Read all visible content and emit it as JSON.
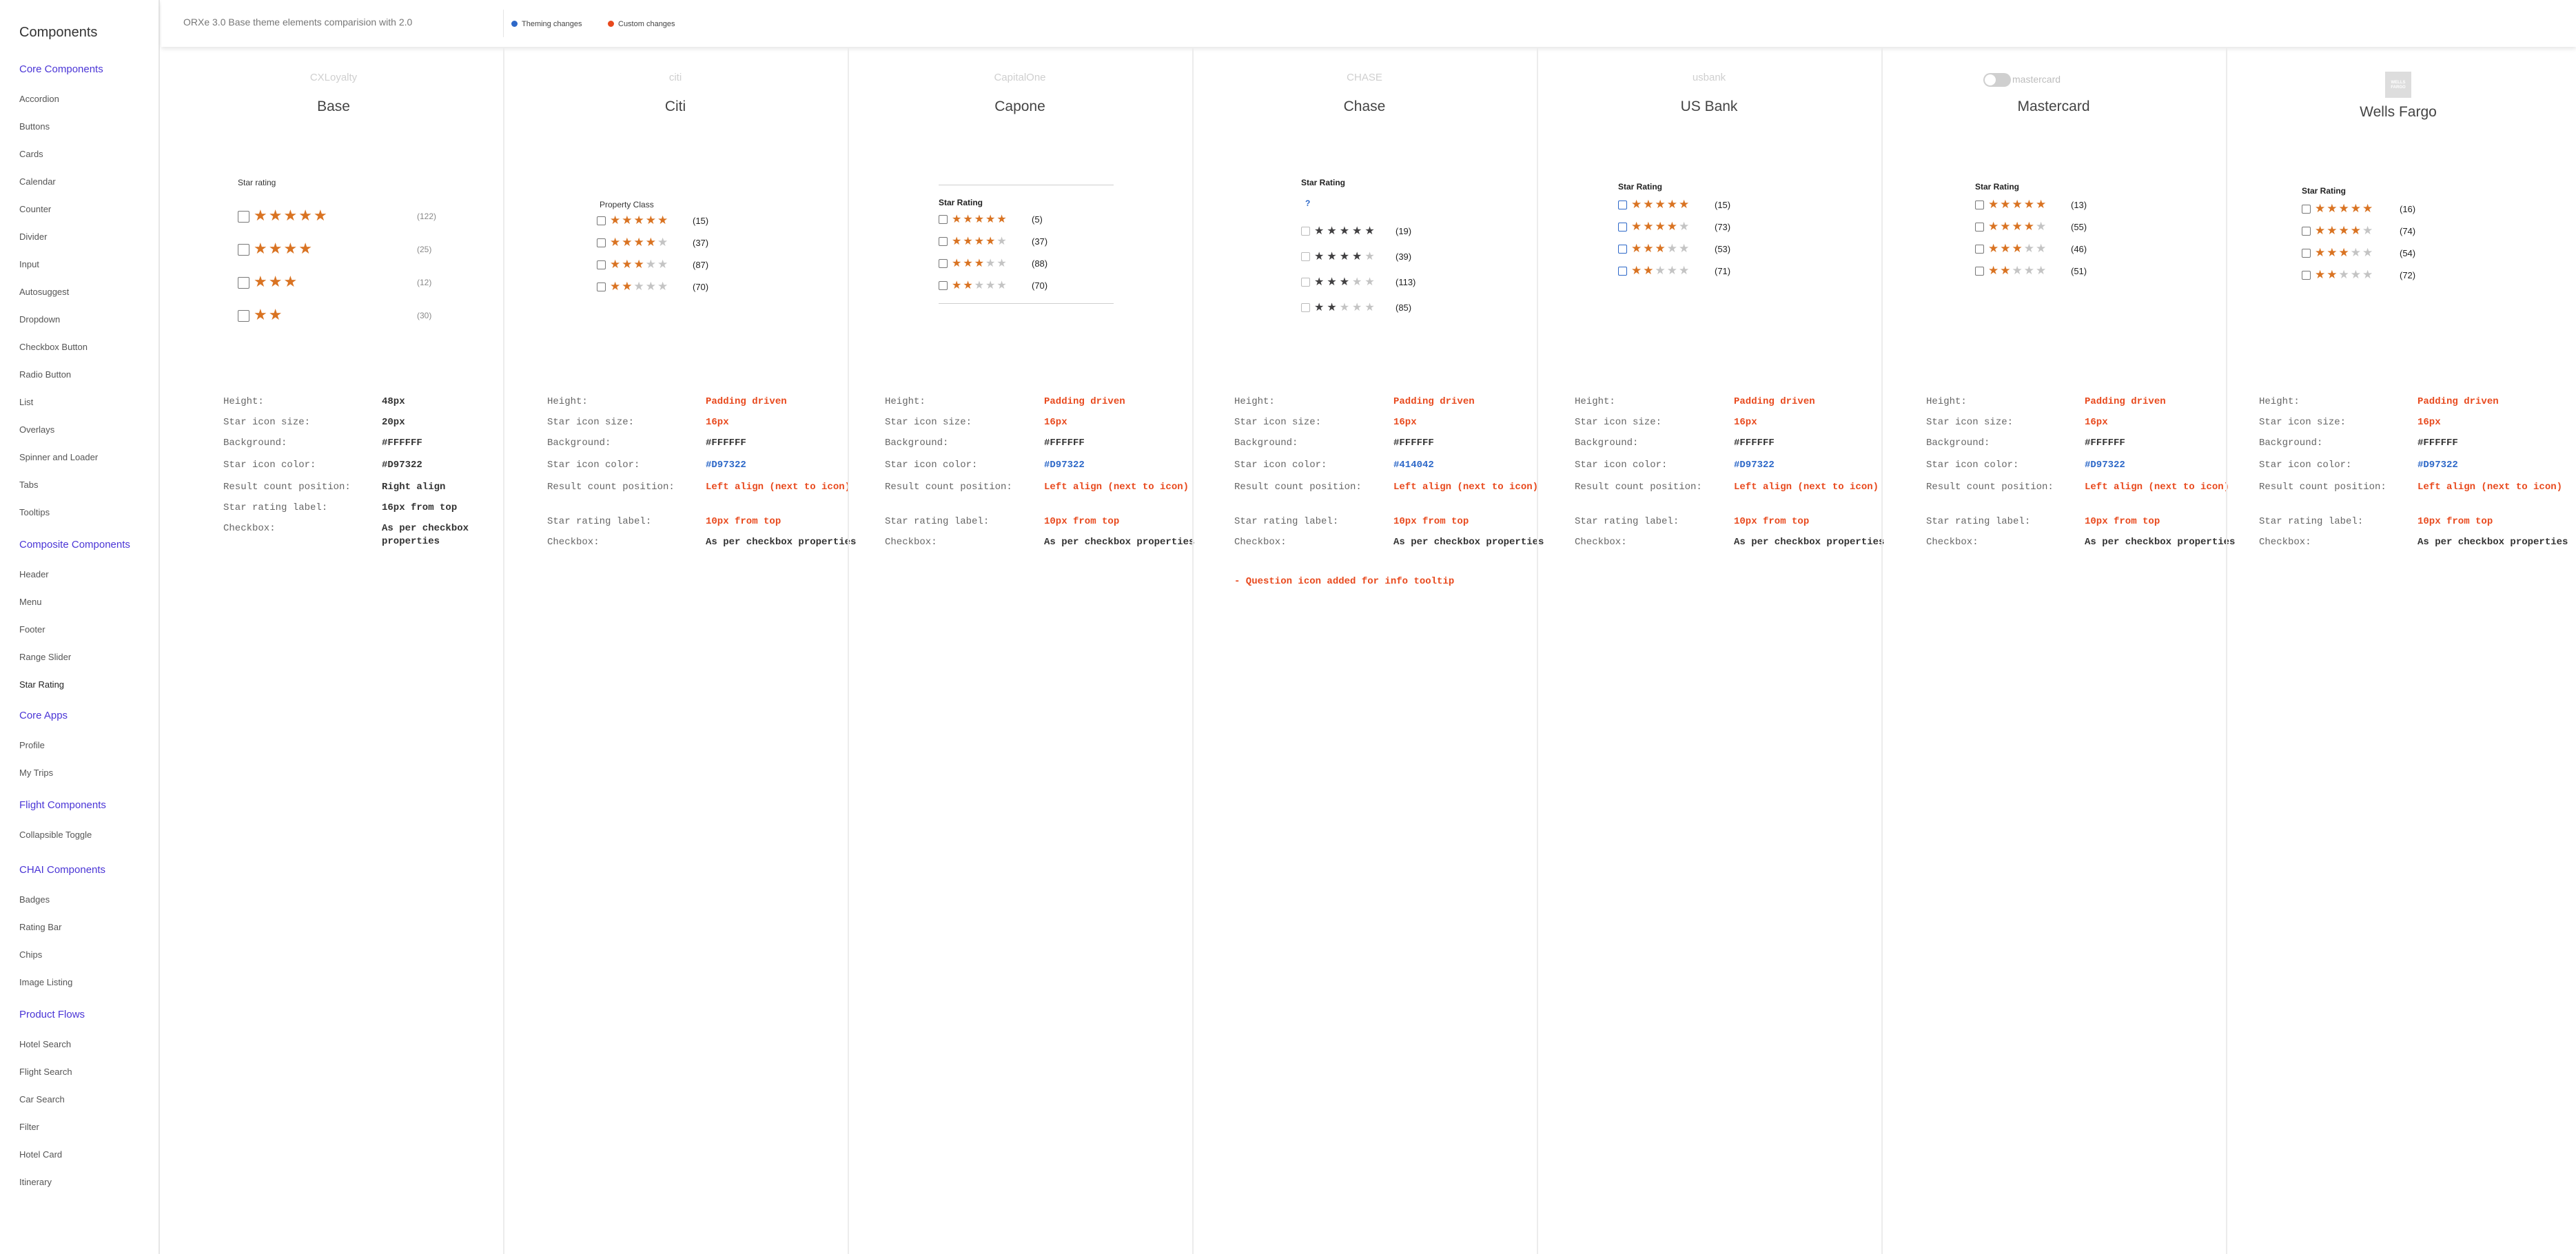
{
  "sidebar": {
    "title": "Components",
    "sections": [
      {
        "label": "Core Components",
        "items": [
          "Accordion",
          "Buttons",
          "Cards",
          "Calendar",
          "Counter",
          "Divider",
          "Input",
          "Autosuggest",
          "Dropdown",
          "Checkbox Button",
          "Radio Button",
          "List",
          "Overlays",
          "Spinner and Loader",
          "Tabs",
          "Tooltips"
        ]
      },
      {
        "label": "Composite Components",
        "items": [
          "Header",
          "Menu",
          "Footer",
          "Range Slider",
          "Star Rating"
        ]
      },
      {
        "label": "Core Apps",
        "items": [
          "Profile",
          "My Trips"
        ]
      },
      {
        "label": "Flight Components",
        "items": [
          "Collapsible Toggle"
        ]
      },
      {
        "label": "CHAI Components",
        "items": [
          "Badges",
          "Rating Bar",
          "Chips",
          "Image Listing"
        ]
      },
      {
        "label": "Product Flows",
        "items": [
          "Hotel Search",
          "Flight Search",
          "Car Search",
          "Filter",
          "Hotel Card",
          "Itinerary"
        ]
      }
    ],
    "active_item": "Star Rating"
  },
  "header": {
    "subtitle": "ORXe 3.0 Base theme elements comparision with 2.0",
    "legend": [
      {
        "label": "Theming changes",
        "color": "#2d68c8"
      },
      {
        "label": "Custom changes",
        "color": "#e8491d"
      }
    ]
  },
  "property_labels": [
    "Height:",
    "Star icon size:",
    "Background:",
    "Star icon color:",
    "Result count position:",
    "Star rating label:",
    "Checkbox:"
  ],
  "brands": [
    {
      "name": "Base",
      "logo_text": "CXLoyalty",
      "rating_label": "Star rating",
      "star_color": "#D97322",
      "rows": [
        {
          "filled": 5,
          "count": "(122)"
        },
        {
          "filled": 4,
          "count": "(25)"
        },
        {
          "filled": 3,
          "count": "(12)"
        },
        {
          "filled": 2,
          "count": "(30)"
        }
      ],
      "props": [
        {
          "value": "48px",
          "color": "black"
        },
        {
          "value": "20px",
          "color": "black"
        },
        {
          "value": "#FFFFFF",
          "color": "black"
        },
        {
          "value": "#D97322",
          "color": "black"
        },
        {
          "value": "Right align",
          "color": "black"
        },
        {
          "value": "16px from top",
          "color": "black"
        },
        {
          "value": "As per checkbox properties",
          "color": "black"
        }
      ]
    },
    {
      "name": "Citi",
      "logo_text": "citi",
      "rating_label": "Property Class",
      "star_color": "#D97322",
      "rows": [
        {
          "filled": 5,
          "count": "(15)"
        },
        {
          "filled": 4,
          "count": "(37)"
        },
        {
          "filled": 3,
          "count": "(87)"
        },
        {
          "filled": 2,
          "count": "(70)"
        }
      ],
      "props": [
        {
          "value": "Padding driven",
          "color": "orange"
        },
        {
          "value": "16px",
          "color": "orange"
        },
        {
          "value": "#FFFFFF",
          "color": "black"
        },
        {
          "value": "#D97322",
          "color": "blue"
        },
        {
          "value": "Left align (next to icon)",
          "color": "orange"
        },
        {
          "value": "10px from top",
          "color": "orange"
        },
        {
          "value": "As per checkbox properties",
          "color": "black"
        }
      ]
    },
    {
      "name": "Capone",
      "logo_text": "CapitalOne",
      "rating_label": "Star Rating",
      "star_color": "#D97322",
      "rows": [
        {
          "filled": 5,
          "count": "(5)"
        },
        {
          "filled": 4,
          "count": "(37)"
        },
        {
          "filled": 3,
          "count": "(88)"
        },
        {
          "filled": 2,
          "count": "(70)"
        }
      ],
      "props": [
        {
          "value": "Padding driven",
          "color": "orange"
        },
        {
          "value": "16px",
          "color": "orange"
        },
        {
          "value": "#FFFFFF",
          "color": "black"
        },
        {
          "value": "#D97322",
          "color": "blue"
        },
        {
          "value": "Left align (next to icon)",
          "color": "orange"
        },
        {
          "value": "10px from top",
          "color": "orange"
        },
        {
          "value": "As per checkbox properties",
          "color": "black"
        }
      ]
    },
    {
      "name": "Chase",
      "logo_text": "CHASE",
      "rating_label": "Star Rating",
      "question_icon": "?",
      "star_color": "#414042",
      "rows": [
        {
          "filled": 5,
          "count": "(19)"
        },
        {
          "filled": 4,
          "count": "(39)"
        },
        {
          "filled": 3,
          "count": "(113)"
        },
        {
          "filled": 2,
          "count": "(85)"
        }
      ],
      "props": [
        {
          "value": "Padding driven",
          "color": "orange"
        },
        {
          "value": "16px",
          "color": "orange"
        },
        {
          "value": "#FFFFFF",
          "color": "black"
        },
        {
          "value": "#414042",
          "color": "blue"
        },
        {
          "value": "Left align (next to icon)",
          "color": "orange"
        },
        {
          "value": "10px from top",
          "color": "orange"
        },
        {
          "value": "As per checkbox properties",
          "color": "black"
        }
      ],
      "note": "- Question icon added for info tooltip"
    },
    {
      "name": "US Bank",
      "logo_text": "usbank",
      "rating_label": "Star Rating",
      "star_color": "#D97322",
      "rows": [
        {
          "filled": 5,
          "count": "(15)"
        },
        {
          "filled": 4,
          "count": "(73)"
        },
        {
          "filled": 3,
          "count": "(53)"
        },
        {
          "filled": 2,
          "count": "(71)"
        }
      ],
      "props": [
        {
          "value": "Padding driven",
          "color": "orange"
        },
        {
          "value": "16px",
          "color": "orange"
        },
        {
          "value": "#FFFFFF",
          "color": "black"
        },
        {
          "value": "#D97322",
          "color": "blue"
        },
        {
          "value": "Left align (next to icon)",
          "color": "orange"
        },
        {
          "value": "10px from top",
          "color": "orange"
        },
        {
          "value": "As per checkbox properties",
          "color": "black"
        }
      ]
    },
    {
      "name": "Mastercard",
      "logo_text": "mastercard",
      "rating_label": "Star Rating",
      "star_color": "#D97322",
      "rows": [
        {
          "filled": 5,
          "count": "(13)"
        },
        {
          "filled": 4,
          "count": "(55)"
        },
        {
          "filled": 3,
          "count": "(46)"
        },
        {
          "filled": 2,
          "count": "(51)"
        }
      ],
      "props": [
        {
          "value": "Padding driven",
          "color": "orange"
        },
        {
          "value": "16px",
          "color": "orange"
        },
        {
          "value": "#FFFFFF",
          "color": "black"
        },
        {
          "value": "#D97322",
          "color": "blue"
        },
        {
          "value": "Left align (next to icon)",
          "color": "orange"
        },
        {
          "value": "10px from top",
          "color": "orange"
        },
        {
          "value": "As per checkbox properties",
          "color": "black"
        }
      ]
    },
    {
      "name": "Wells Fargo",
      "logo_text": "WELLS FARGO",
      "rating_label": "Star Rating",
      "star_color": "#D97322",
      "rows": [
        {
          "filled": 5,
          "count": "(16)"
        },
        {
          "filled": 4,
          "count": "(74)"
        },
        {
          "filled": 3,
          "count": "(54)"
        },
        {
          "filled": 2,
          "count": "(72)"
        }
      ],
      "props": [
        {
          "value": "Padding driven",
          "color": "orange"
        },
        {
          "value": "16px",
          "color": "orange"
        },
        {
          "value": "#FFFFFF",
          "color": "black"
        },
        {
          "value": "#D97322",
          "color": "blue"
        },
        {
          "value": "Left align (next to icon)",
          "color": "orange"
        },
        {
          "value": "10px from top",
          "color": "orange"
        },
        {
          "value": "As per checkbox properties",
          "color": "black"
        }
      ]
    }
  ]
}
